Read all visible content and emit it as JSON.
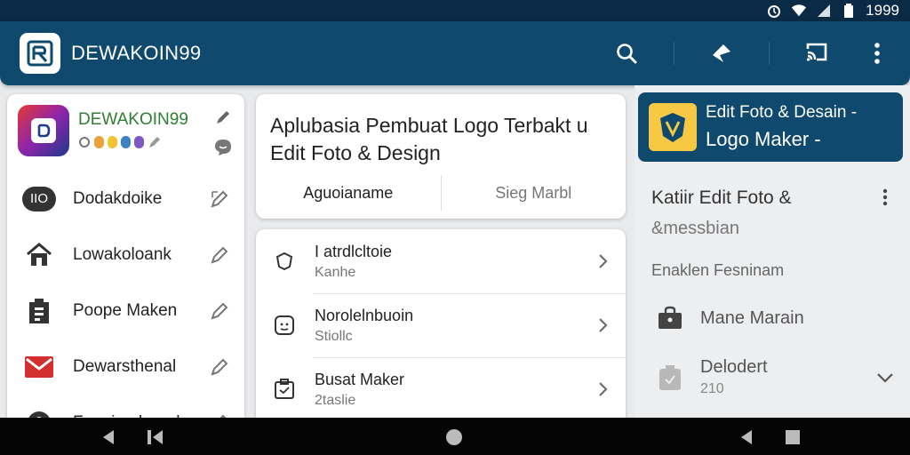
{
  "status_bar": {
    "time": "1999",
    "icons": [
      "alarm-icon",
      "wifi-icon",
      "signal-icon",
      "battery-icon"
    ]
  },
  "app_bar": {
    "title": "DEWAKOIN99",
    "actions": [
      "search-icon",
      "share-icon",
      "cast-icon",
      "more-vert-icon"
    ]
  },
  "left_panel": {
    "profile": {
      "name": "DEWAKOIN99",
      "name_color": "#2e7d32"
    },
    "items": [
      {
        "label": "Dodakdoike",
        "badge": "IIO",
        "icon": "badge-icon"
      },
      {
        "label": "Lowakoloank",
        "icon": "home-icon"
      },
      {
        "label": "Poope Maken",
        "icon": "document-icon"
      },
      {
        "label": "Dewarsthenal",
        "icon": "mail-icon"
      },
      {
        "label": "Fonaimahenal",
        "icon": "user-icon"
      }
    ]
  },
  "main": {
    "header": {
      "title_line1": "Aplubasia Pembuat Logo Terbakt u",
      "title_line2": "Edit Foto & Design",
      "tabs": [
        {
          "label": "Aguoianame",
          "active": true
        },
        {
          "label": "Sieg Marbl",
          "active": false
        }
      ]
    },
    "list": [
      {
        "title": "I atrdlcltoie",
        "subtitle": "Kanhe",
        "icon": "shield-icon"
      },
      {
        "title": "Norolelnbuoin",
        "subtitle": "Stiollc",
        "icon": "face-frame-icon"
      },
      {
        "title": "Busat Maker",
        "subtitle": "2taslie",
        "icon": "clipboard-icon"
      }
    ]
  },
  "right_panel": {
    "banner": {
      "line1": "Edit Foto & Desain -",
      "line2": "Logo  Maker -"
    },
    "title_line1": "Katiir Edit Foto &",
    "title_line2": "&messbian",
    "section_label": "Enaklen Fesninam",
    "items": [
      {
        "label": "Mane Marain",
        "icon": "bag-icon"
      },
      {
        "label": "Delodert",
        "subtitle": "210",
        "icon": "tag-icon",
        "expandable": true
      }
    ]
  },
  "colors": {
    "primary": "#0f4a6e",
    "status_bar": "#0b2a45",
    "banner_icon": "#f6c844",
    "nav_bar": "#050505"
  }
}
